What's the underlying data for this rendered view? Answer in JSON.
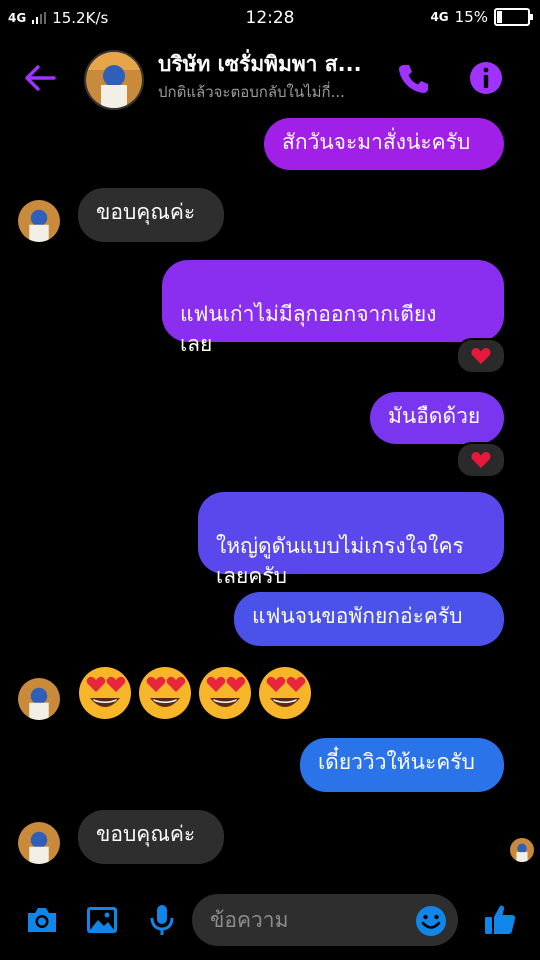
{
  "status_bar": {
    "network_left": "4G",
    "speed": "15.2K/s",
    "time": "12:28",
    "network_right": "4G",
    "battery_percent": "15%",
    "battery_level": 0.15
  },
  "header": {
    "contact_name": "บริษัท เซรั่มพิมพา ส...",
    "contact_status": "ปกติแล้วจะตอบกลับในไม่กี่..."
  },
  "messages": [
    {
      "direction": "out",
      "text": "สักวันจะมาสั่งน่ะครับ",
      "color": "#a020e8"
    },
    {
      "direction": "in",
      "text": "ขอบคุณค่ะ"
    },
    {
      "direction": "out",
      "text": "แฟนเก่าไม่มีลุกออกจากเตียง\nเลย",
      "color": "#8a2ef0",
      "reaction": "heart"
    },
    {
      "direction": "out",
      "text": "มันอืดด้วย",
      "color": "#7a35ee",
      "reaction": "heart"
    },
    {
      "direction": "out",
      "text": "ใหญ่ดูดันแบบไม่เกรงใจใคร\nเลยครับ",
      "color": "#5a48ec"
    },
    {
      "direction": "out",
      "text": "แฟนจนขอพักยกอ่ะครับ",
      "color": "#4a52ea"
    },
    {
      "direction": "in",
      "type": "emoji",
      "emoji": [
        "smiling-face-heart-eyes",
        "smiling-face-heart-eyes",
        "smiling-face-heart-eyes",
        "smiling-face-heart-eyes"
      ]
    },
    {
      "direction": "out",
      "text": "เดี๋ยววิวให้นะครับ",
      "color": "#2a73e8"
    },
    {
      "direction": "in",
      "text": "ขอบคุณค่ะ"
    }
  ],
  "composer": {
    "placeholder": "ข้อความ"
  },
  "colors": {
    "accent": "#a033ff",
    "composer_blue": "#0f86e8",
    "background": "#000000",
    "incoming_bubble": "#2e2e2e",
    "reaction_heart": "#e8173c"
  }
}
